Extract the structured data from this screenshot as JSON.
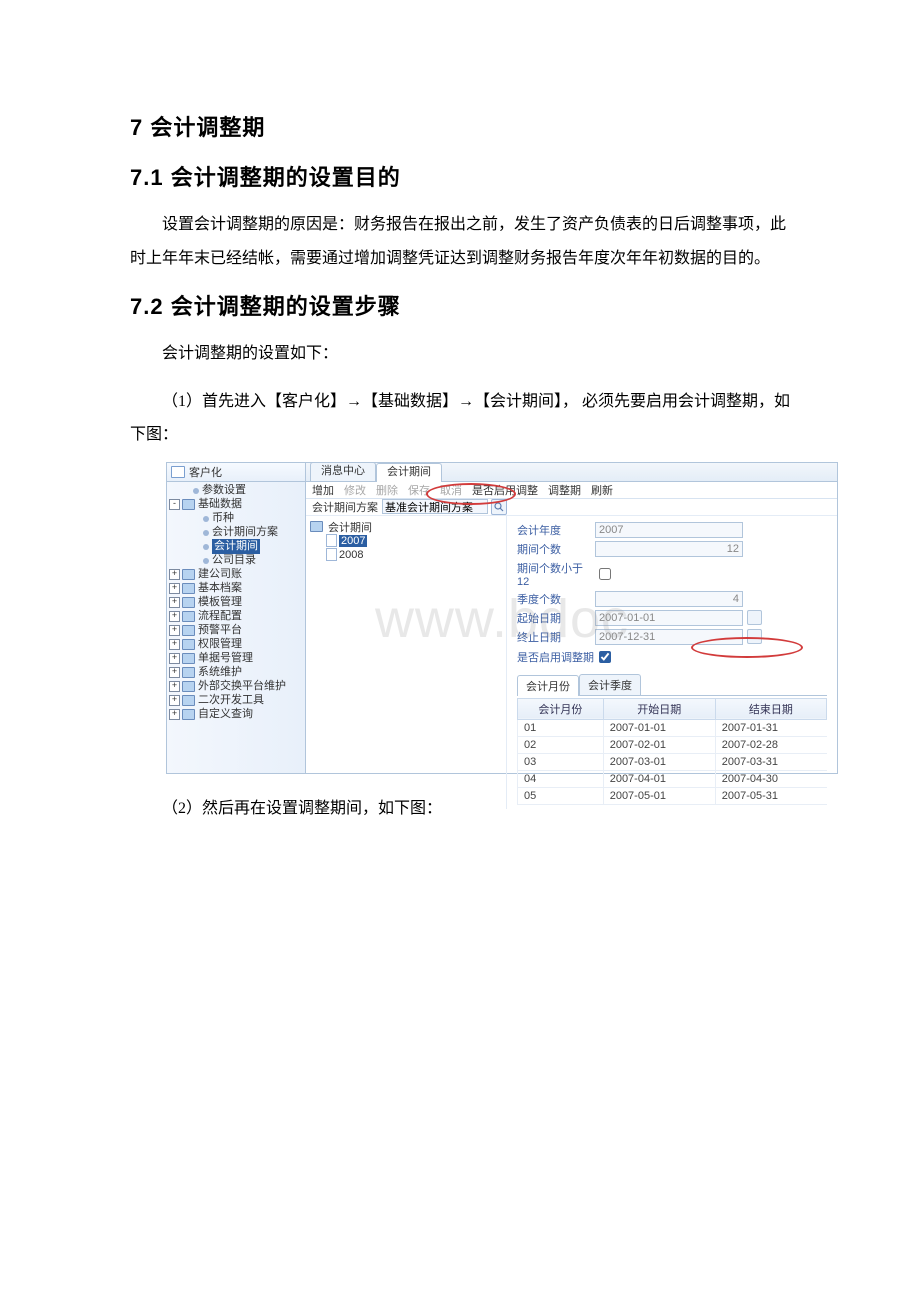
{
  "headings": {
    "section": "7 会计调整期",
    "sub1": "7.1 会计调整期的设置目的",
    "sub2": "7.2 会计调整期的设置步骤"
  },
  "paragraphs": {
    "purpose": "设置会计调整期的原因是：财务报告在报出之前，发生了资产负债表的日后调整事项，此时上年年末已经结帐，需要通过增加调整凭证达到调整财务报告年度次年年初数据的目的。",
    "intro": "会计调整期的设置如下：",
    "step1": "（1）首先进入【客户化】→【基础数据】→【会计期间】， 必须先要启用会计调整期，如下图：",
    "step2": "（2）然后再在设置调整期间，如下图："
  },
  "watermark": "www.bdoc",
  "ui": {
    "sidebar": {
      "title": "客户化",
      "tree": [
        {
          "text": "参数设置",
          "depth": 1,
          "icon": "bullet",
          "box": null
        },
        {
          "text": "基础数据",
          "depth": 0,
          "icon": "folder",
          "box": "-"
        },
        {
          "text": "币种",
          "depth": 2,
          "icon": "bullet",
          "box": null
        },
        {
          "text": "会计期间方案",
          "depth": 2,
          "icon": "bullet",
          "box": null
        },
        {
          "text": "会计期间",
          "depth": 2,
          "icon": "bullet",
          "box": null,
          "selected": true
        },
        {
          "text": "公司目录",
          "depth": 2,
          "icon": "bullet",
          "box": null
        },
        {
          "text": "建公司账",
          "depth": 0,
          "icon": "folder",
          "box": "+"
        },
        {
          "text": "基本档案",
          "depth": 0,
          "icon": "folder",
          "box": "+"
        },
        {
          "text": "模板管理",
          "depth": 0,
          "icon": "folder",
          "box": "+"
        },
        {
          "text": "流程配置",
          "depth": 0,
          "icon": "folder",
          "box": "+"
        },
        {
          "text": "预警平台",
          "depth": 0,
          "icon": "folder",
          "box": "+"
        },
        {
          "text": "权限管理",
          "depth": 0,
          "icon": "folder",
          "box": "+"
        },
        {
          "text": "单据号管理",
          "depth": 0,
          "icon": "folder",
          "box": "+"
        },
        {
          "text": "系统维护",
          "depth": 0,
          "icon": "folder",
          "box": "+"
        },
        {
          "text": "外部交换平台维护",
          "depth": 0,
          "icon": "folder",
          "box": "+"
        },
        {
          "text": "二次开发工具",
          "depth": 0,
          "icon": "folder",
          "box": "+"
        },
        {
          "text": "自定义查询",
          "depth": 0,
          "icon": "folder",
          "box": "+"
        }
      ]
    },
    "tabs": {
      "msg": "消息中心",
      "page": "会计期间"
    },
    "toolbar": {
      "add": "增加",
      "edit": "修改",
      "del": "删除",
      "save": "保存",
      "cancel": "取消",
      "enableAdj": "是否启用调整",
      "adjPeriod": "调整期",
      "refresh": "刷新"
    },
    "scheme": {
      "label": "会计期间方案",
      "value": "基准会计期间方案"
    },
    "periodTree": {
      "root": "会计期间",
      "items": [
        {
          "label": "2007",
          "selected": true
        },
        {
          "label": "2008",
          "selected": false
        }
      ]
    },
    "form": {
      "year_label": "会计年度",
      "year": "2007",
      "count_label": "期间个数",
      "count": "12",
      "lt12_label": "期间个数小于12",
      "quarter_label": "季度个数",
      "quarter": "4",
      "start_label": "起始日期",
      "start": "2007-01-01",
      "end_label": "终止日期",
      "end": "2007-12-31",
      "enable_label": "是否启用调整期"
    },
    "innerTabs": {
      "month": "会计月份",
      "quarter": "会计季度"
    },
    "monthsTable": {
      "headers": {
        "m": "会计月份",
        "s": "开始日期",
        "e": "结束日期"
      },
      "rows": [
        {
          "m": "01",
          "s": "2007-01-01",
          "e": "2007-01-31"
        },
        {
          "m": "02",
          "s": "2007-02-01",
          "e": "2007-02-28"
        },
        {
          "m": "03",
          "s": "2007-03-01",
          "e": "2007-03-31"
        },
        {
          "m": "04",
          "s": "2007-04-01",
          "e": "2007-04-30"
        },
        {
          "m": "05",
          "s": "2007-05-01",
          "e": "2007-05-31"
        }
      ]
    }
  }
}
